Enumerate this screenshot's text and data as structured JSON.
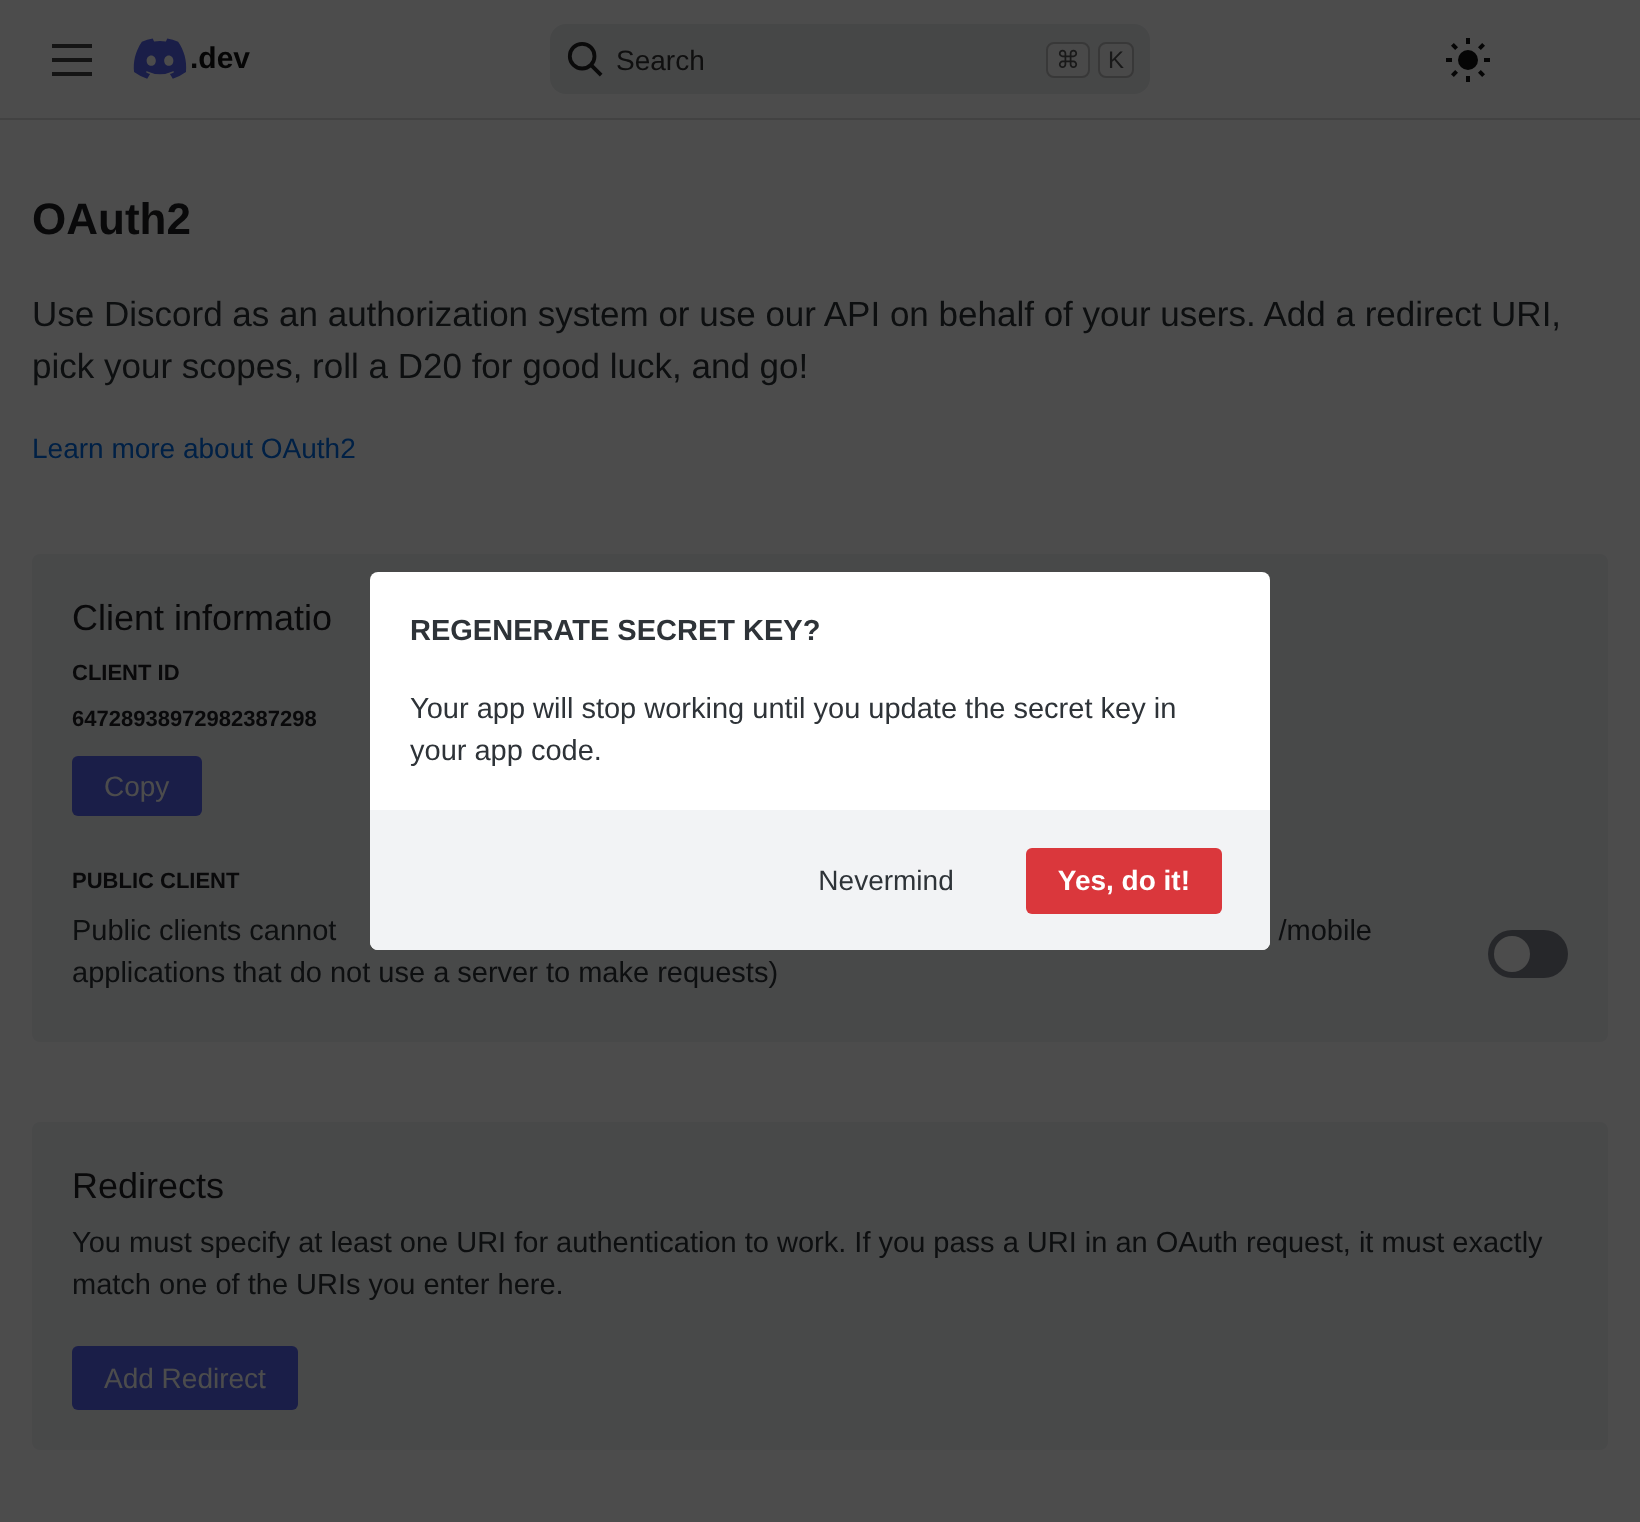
{
  "header": {
    "logo_text": ".dev",
    "search": {
      "placeholder": "Search",
      "keys": [
        "⌘",
        "K"
      ]
    }
  },
  "page": {
    "title": "OAuth2",
    "description": "Use Discord as an authorization system or use our API on behalf of your users. Add a redirect URI, pick your scopes, roll a D20 for good luck, and go!",
    "link": "Learn more about OAuth2"
  },
  "client_card": {
    "title": "Client informatio",
    "client_id_label": "CLIENT ID",
    "client_id": "64728938972982387298",
    "copy_button": "Copy",
    "public_client_label": "PUBLIC CLIENT",
    "public_client_text_left": "Public clients cannot",
    "public_client_text_right": "/mobile",
    "public_client_text_line2": "applications that do not use a server to make requests)",
    "public_client_on": false
  },
  "redirects_card": {
    "title": "Redirects",
    "description": "You must specify at least one URI for authentication to work. If you pass a URI in an OAuth request, it must exactly match one of the URIs you enter here.",
    "button": "Add Redirect"
  },
  "modal": {
    "title": "REGENERATE SECRET KEY?",
    "body": "Your app will stop working until you update the secret key in your app code.",
    "cancel": "Nevermind",
    "confirm": "Yes, do it!"
  }
}
